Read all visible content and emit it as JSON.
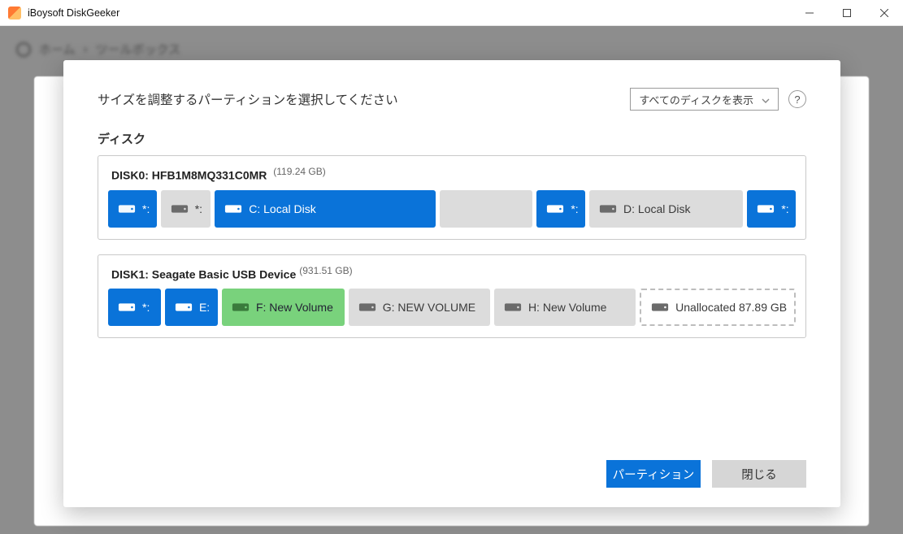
{
  "window": {
    "title": "iBoysoft DiskGeeker"
  },
  "breadcrumb": {
    "home": "ホーム",
    "sep": "›",
    "tool": "ツールボックス"
  },
  "dialog": {
    "title": "サイズを調整するパーティションを選択してください",
    "filter_label": "すべてのディスクを表示",
    "help": "?",
    "section_label": "ディスク",
    "disks": [
      {
        "id": "DISK0",
        "name": "HFB1M8MQ331C0MR",
        "capacity": "(119.24 GB)",
        "partitions": [
          {
            "style": "blue",
            "label": "*:"
          },
          {
            "style": "gray",
            "label": "*:"
          },
          {
            "style": "blue",
            "label": "C: Local Disk"
          },
          {
            "style": "empty",
            "label": ""
          },
          {
            "style": "blue",
            "label": "*:"
          },
          {
            "style": "gray",
            "label": "D: Local Disk"
          },
          {
            "style": "blue",
            "label": "*:"
          }
        ]
      },
      {
        "id": "DISK1",
        "name": "Seagate Basic USB Device",
        "capacity": "(931.51 GB)",
        "partitions": [
          {
            "style": "blue",
            "label": "*:"
          },
          {
            "style": "blue",
            "label": "E:"
          },
          {
            "style": "green",
            "label": "F: New Volume"
          },
          {
            "style": "gray",
            "label": "G: NEW VOLUME"
          },
          {
            "style": "gray",
            "label": "H: New Volume"
          },
          {
            "style": "unalloc",
            "label": "Unallocated 87.89 GB"
          }
        ]
      }
    ],
    "buttons": {
      "primary": "パーティション",
      "secondary": "閉じる"
    }
  }
}
